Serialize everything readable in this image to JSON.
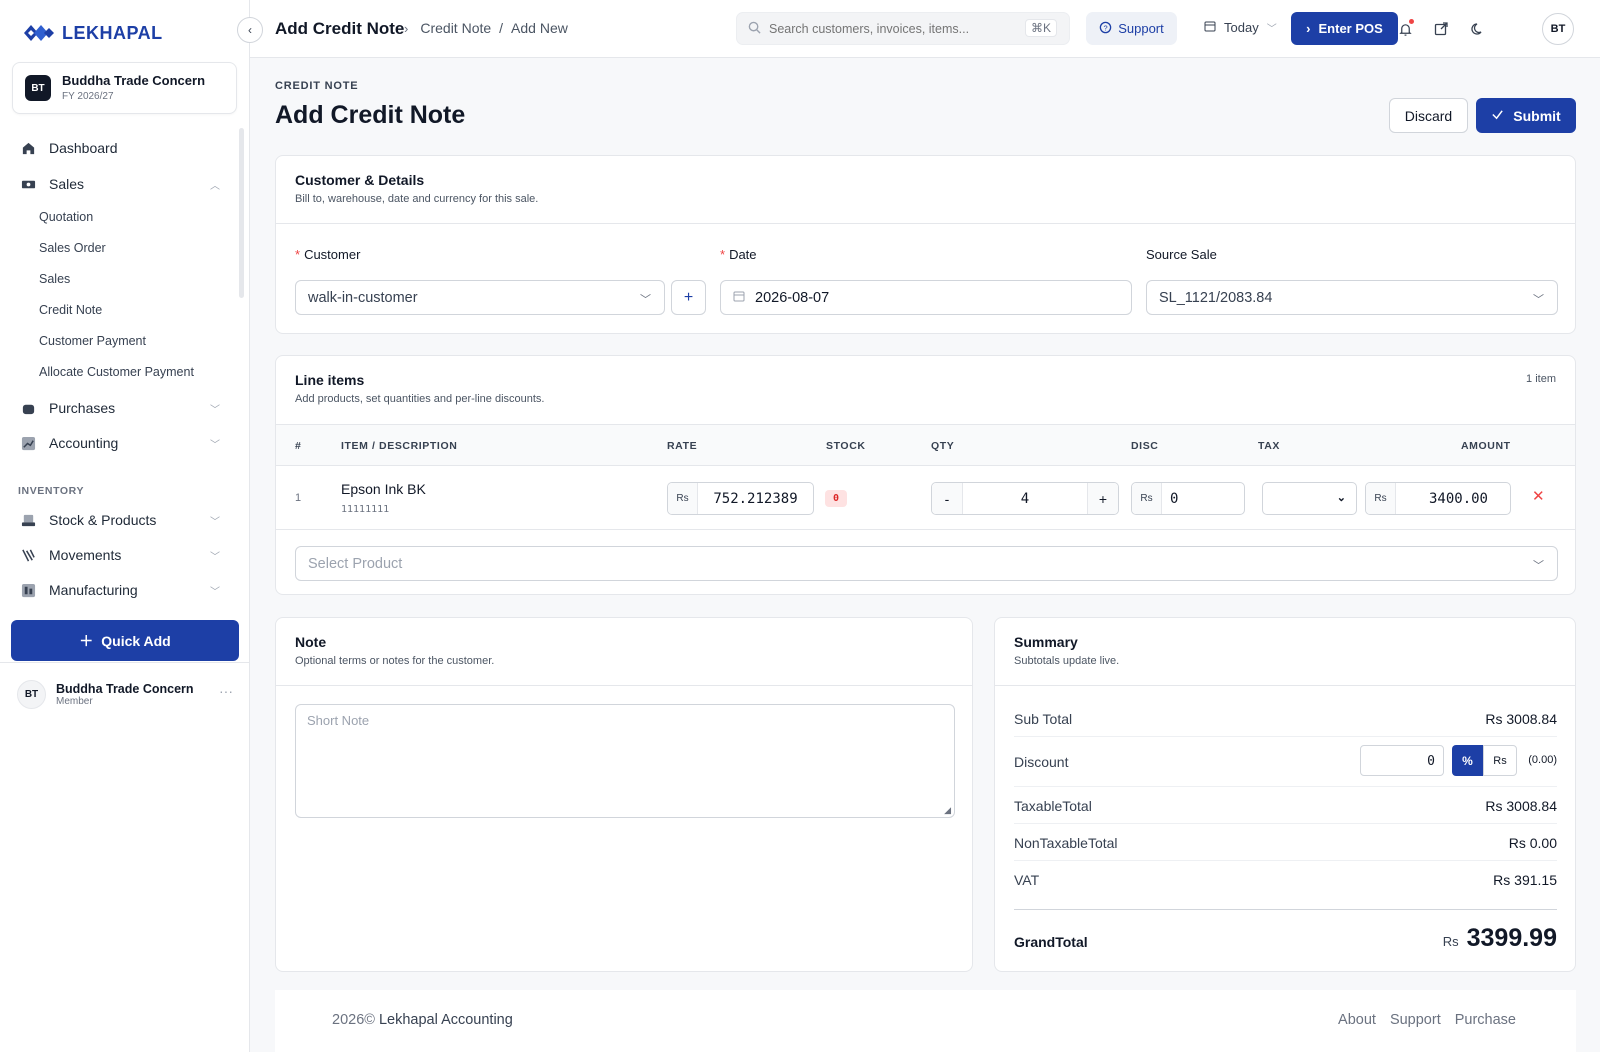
{
  "brand": {
    "name": "LEKHAPAL"
  },
  "org": {
    "badge": "BT",
    "name": "Buddha Trade Concern",
    "fy": "FY 2026/27"
  },
  "sidebar": {
    "items": [
      {
        "label": "Dashboard",
        "icon": "home-icon"
      },
      {
        "label": "Sales",
        "icon": "sales-icon"
      },
      {
        "label": "Purchases",
        "icon": "bag-icon"
      },
      {
        "label": "Accounting",
        "icon": "chart-icon"
      },
      {
        "label": "Stock & Products",
        "icon": "box-icon"
      },
      {
        "label": "Movements",
        "icon": "movements-icon"
      },
      {
        "label": "Manufacturing",
        "icon": "factory-icon"
      }
    ],
    "sales_sub": [
      "Quotation",
      "Sales Order",
      "Sales",
      "Credit Note",
      "Customer Payment",
      "Allocate Customer Payment"
    ],
    "section_inventory": "INVENTORY",
    "quick_add": "Quick Add",
    "user": {
      "initials": "BT",
      "name": "Buddha Trade Concern",
      "role": "Member"
    }
  },
  "topbar": {
    "title": "Add Credit Note",
    "crumb_1": "Credit Note",
    "crumb_sep": "/",
    "crumb_2": "Add New",
    "search_placeholder": "Search customers, invoices, items...",
    "search_kbd": "⌘K",
    "support": "Support",
    "today": "Today",
    "enter_pos": "Enter POS",
    "avatar": "BT"
  },
  "page": {
    "eyebrow": "CREDIT NOTE",
    "title": "Add Credit Note",
    "discard": "Discard",
    "submit": "Submit"
  },
  "details": {
    "title": "Customer & Details",
    "subtitle": "Bill to, warehouse, date and currency for this sale.",
    "customer_label": "Customer",
    "customer_value": "walk-in-customer",
    "date_label": "Date",
    "date_value": "2026-08-07",
    "source_label": "Source Sale",
    "source_value": "SL_1121/2083.84"
  },
  "lines": {
    "title": "Line items",
    "subtitle": "Add products, set quantities and per-line discounts.",
    "count": "1 item",
    "headers": [
      "#",
      "ITEM / DESCRIPTION",
      "RATE",
      "STOCK",
      "QTY",
      "DISC",
      "TAX",
      "AMOUNT"
    ],
    "rows": [
      {
        "index": "1",
        "name": "Epson Ink BK",
        "code": "11111111",
        "currency": "Rs",
        "rate": "752.212389",
        "stock": "0",
        "qty": "4",
        "disc": "0",
        "tax": "",
        "amount": "3400.00"
      }
    ],
    "qty_minus": "-",
    "qty_plus": "+",
    "select_product": "Select Product"
  },
  "note": {
    "title": "Note",
    "subtitle": "Optional terms or notes for the customer.",
    "placeholder": "Short Note"
  },
  "summary": {
    "title": "Summary",
    "subtitle": "Subtotals update live.",
    "sub_total_label": "Sub Total",
    "sub_total": "Rs 3008.84",
    "discount_label": "Discount",
    "discount_value": "0",
    "discount_pct": "%",
    "discount_rs": "Rs",
    "discount_calc": "(0.00)",
    "taxable_label": "TaxableTotal",
    "taxable": "Rs 3008.84",
    "nontaxable_label": "NonTaxableTotal",
    "nontaxable": "Rs 0.00",
    "vat_label": "VAT",
    "vat": "Rs 391.15",
    "grand_label": "GrandTotal",
    "grand_currency": "Rs",
    "grand": "3399.99"
  },
  "footer": {
    "copyright": "2026©",
    "company": "Lekhapal Accounting",
    "links": [
      "About",
      "Support",
      "Purchase"
    ]
  },
  "colors": {
    "primary": "#1d3fa6",
    "danger": "#ef4444"
  }
}
